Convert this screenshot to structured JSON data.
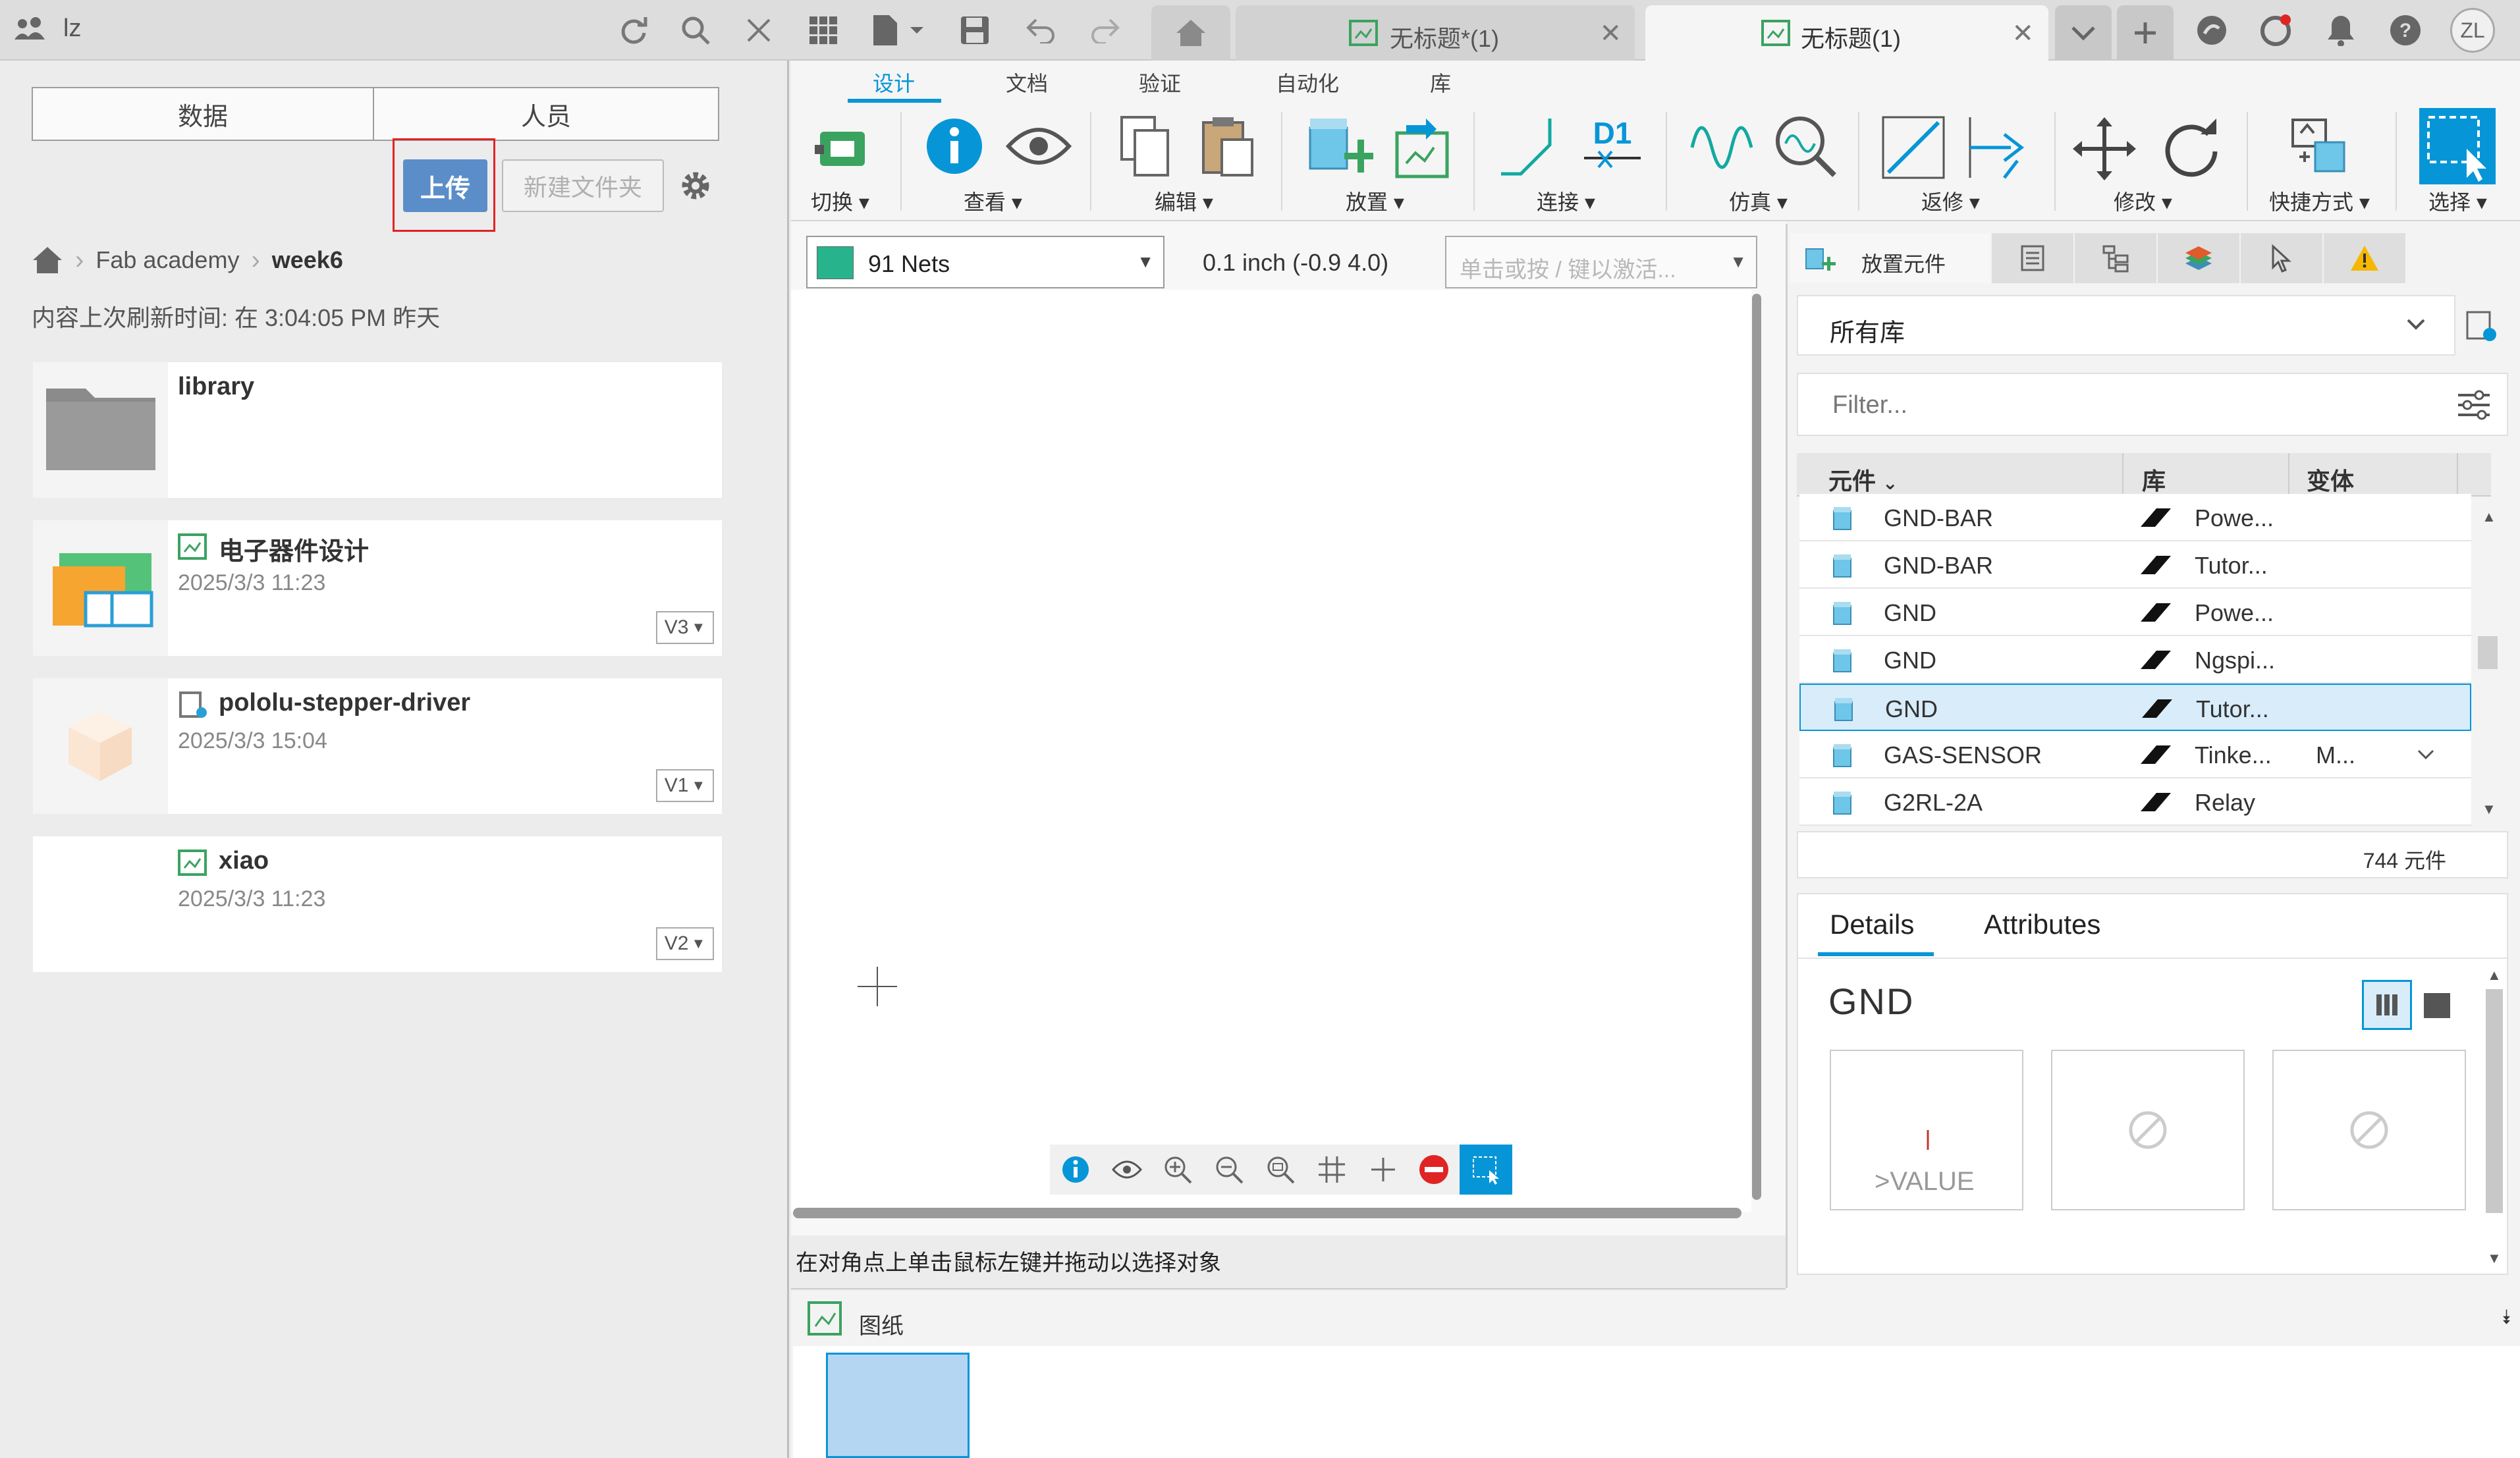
{
  "topbar": {
    "account_name": "lz",
    "tabs": [
      {
        "label": "无标题*(1)",
        "active": false
      },
      {
        "label": "无标题(1)",
        "active": true
      }
    ],
    "user_initials": "ZL"
  },
  "left_panel": {
    "segments": [
      "数据",
      "人员"
    ],
    "upload_label": "上传",
    "new_folder_label": "新建文件夹",
    "breadcrumb": [
      "Fab academy",
      "week6"
    ],
    "refresh_text": "内容上次刷新时间: 在 3:04:05 PM 昨天",
    "items": [
      {
        "name": "library",
        "date": "",
        "version": ""
      },
      {
        "name": "电子器件设计",
        "date": "2025/3/3 11:23",
        "version": "V3"
      },
      {
        "name": "pololu-stepper-driver",
        "date": "2025/3/3 15:04",
        "version": "V1"
      },
      {
        "name": "xiao",
        "date": "2025/3/3 11:23",
        "version": "V2"
      }
    ]
  },
  "ribbon": {
    "tabs": [
      "设计",
      "文档",
      "验证",
      "自动化",
      "库"
    ],
    "active_tab": "设计",
    "groups": [
      "切换",
      "查看",
      "编辑",
      "放置",
      "连接",
      "仿真",
      "返修",
      "修改",
      "快捷方式",
      "选择"
    ],
    "d1_label": "D1"
  },
  "toolbar": {
    "net_select": "91 Nets",
    "grid_text": "0.1 inch (-0.9 4.0)",
    "command_placeholder": "单击或按 / 键以激活..."
  },
  "canvas": {
    "status_text": "在对角点上单击鼠标左键并拖动以选择对象"
  },
  "sheets": {
    "label": "图纸"
  },
  "parts": {
    "panel_title": "放置元件",
    "library_select": "所有库",
    "filter_placeholder": "Filter...",
    "columns": [
      "元件",
      "库",
      "变体"
    ],
    "rows": [
      {
        "part": "GND-BAR",
        "lib": "Powe...",
        "variant": ""
      },
      {
        "part": "GND-BAR",
        "lib": "Tutor...",
        "variant": ""
      },
      {
        "part": "GND",
        "lib": "Powe...",
        "variant": ""
      },
      {
        "part": "GND",
        "lib": "Ngspi...",
        "variant": ""
      },
      {
        "part": "GND",
        "lib": "Tutor...",
        "variant": "",
        "selected": true
      },
      {
        "part": "GAS-SENSOR",
        "lib": "Tinke...",
        "variant": "M..."
      },
      {
        "part": "G2RL-2A",
        "lib": "Relay",
        "variant": ""
      }
    ],
    "count": "744 元件",
    "details_tabs": [
      "Details",
      "Attributes"
    ],
    "selected_name": "GND",
    "symbol_value": ">VALUE"
  },
  "colors": {
    "accent": "#0696d7",
    "upload_btn": "#5b8ec9",
    "selected_row": "#d8ecfa",
    "net_swatch": "#27b48c"
  }
}
